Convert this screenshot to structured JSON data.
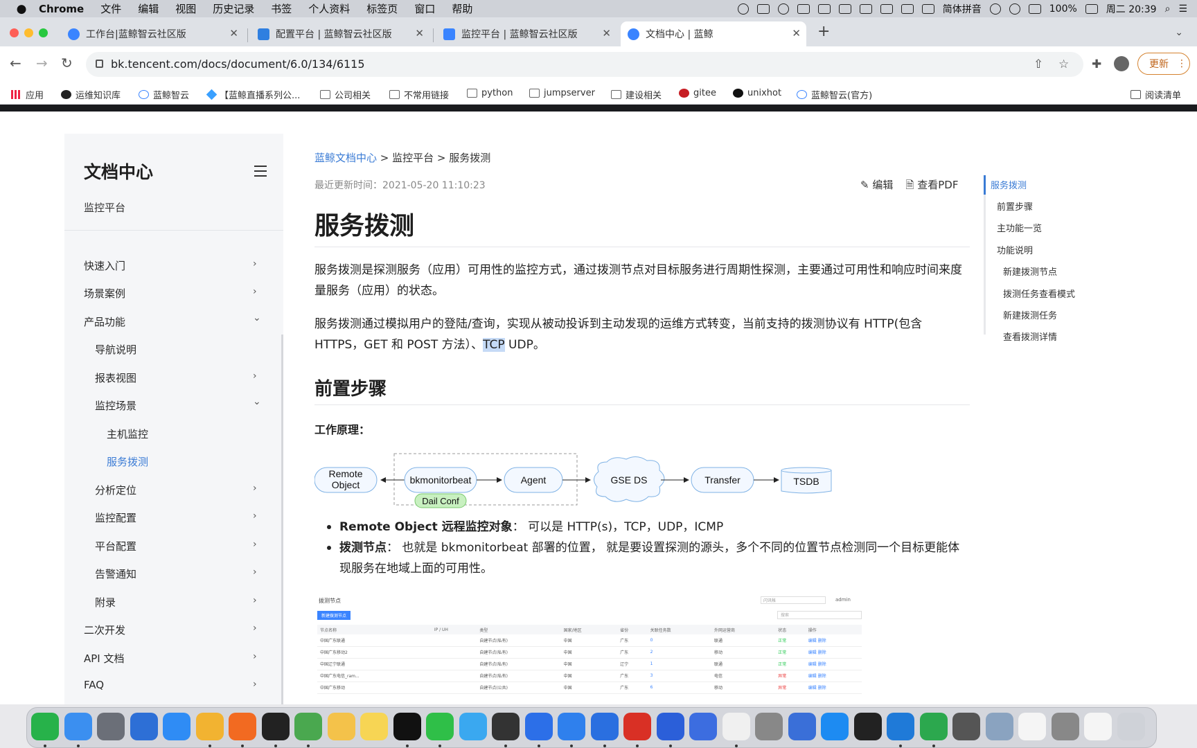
{
  "menubar": {
    "items": [
      "Chrome",
      "文件",
      "编辑",
      "视图",
      "历史记录",
      "书签",
      "个人资料",
      "标签页",
      "窗口",
      "帮助"
    ],
    "battery": "100%",
    "input_method": "简体拼音",
    "datetime": "周二 20:39"
  },
  "tabs": [
    {
      "title": "工作台|蓝鲸智云社区版",
      "active": false
    },
    {
      "title": "配置平台 | 蓝鲸智云社区版",
      "active": false
    },
    {
      "title": "监控平台 | 蓝鲸智云社区版",
      "active": false
    },
    {
      "title": "文档中心 | 蓝鲸",
      "active": true
    }
  ],
  "address": {
    "url": "bk.tencent.com/docs/document/6.0/134/6115",
    "update_label": "更新"
  },
  "bookmarks": {
    "items": [
      "应用",
      "运维知识库",
      "蓝鲸智云",
      "【蓝鲸直播系列公...",
      "公司相关",
      "不常用链接",
      "python",
      "jumpserver",
      "建设相关",
      "gitee",
      "unixhot",
      "蓝鲸智云(官方)"
    ],
    "reading_list": "阅读清单"
  },
  "sidebar": {
    "title": "文档中心",
    "subtitle": "监控平台",
    "items": [
      {
        "label": "快速入门",
        "arrow": "›"
      },
      {
        "label": "场景案例",
        "arrow": "›"
      },
      {
        "label": "产品功能",
        "arrow": "⌄"
      },
      {
        "label": "导航说明",
        "arrow": ""
      },
      {
        "label": "报表视图",
        "arrow": "›"
      },
      {
        "label": "监控场景",
        "arrow": "⌄"
      },
      {
        "label": "主机监控",
        "arrow": ""
      },
      {
        "label": "服务拨测",
        "arrow": ""
      },
      {
        "label": "分析定位",
        "arrow": "›"
      },
      {
        "label": "监控配置",
        "arrow": "›"
      },
      {
        "label": "平台配置",
        "arrow": "›"
      },
      {
        "label": "告警通知",
        "arrow": "›"
      },
      {
        "label": "附录",
        "arrow": "›"
      },
      {
        "label": "二次开发",
        "arrow": "›"
      },
      {
        "label": "API 文档",
        "arrow": "›"
      },
      {
        "label": "FAQ",
        "arrow": "›"
      }
    ]
  },
  "content": {
    "breadcrumb": {
      "root": "蓝鲸文档中心",
      "sep1": " > ",
      "mid": "监控平台",
      "sep2": " > ",
      "current": "服务拨测"
    },
    "updated": "最近更新时间：2021-05-20 11:10:23",
    "edit_label": "编辑",
    "pdf_label": "查看PDF",
    "title": "服务拨测",
    "intro": "服务拨测是探测服务（应用）可用性的监控方式，通过拨测节点对目标服务进行周期性探测，主要通过可用性和响应时间来度量服务（应用）的状态。",
    "protocols_before": "服务拨测通过模拟用户的登陆/查询，实现从被动投诉到主动发现的运维方式转变，当前支持的拨测协议有 HTTP(包含 HTTPS，GET 和 POST 方法）、",
    "protocols_highlight": "TCP",
    "protocols_after": " UDP。",
    "section_title": "前置步骤",
    "principle_label": "工作原理：",
    "diagram": {
      "remote_line1": "Remote",
      "remote_line2": "Object",
      "bkmonitorbeat": "bkmonitorbeat",
      "agent": "Agent",
      "dail_conf": "Dail Conf",
      "gse": "GSE DS",
      "transfer": "Transfer",
      "tsdb": "TSDB"
    },
    "bullets": [
      {
        "bold": "Remote Object 远程监控对象",
        "text": "：  可以是 HTTP(s)，TCP，UDP，ICMP"
      },
      {
        "bold": "拨测节点",
        "text": "：  也就是 bkmonitorbeat 部署的位置， 就是要设置探测的源头，多个不同的位置节点检测同一个目标更能体现服务在地域上面的可用性。"
      }
    ],
    "screenshot": {
      "title": "拨测节点",
      "select": "闪讯帐",
      "admin": "admin",
      "new_button": "新建拨测节点",
      "search": "搜索",
      "columns": [
        "节点名称",
        "IP / UH",
        "类型",
        "国家/地区",
        "省份",
        "关联任务数",
        "外网运营商",
        "状态",
        "操作"
      ],
      "rows": [
        [
          "中国广东联通",
          "",
          "自建节点(私有)",
          "中国",
          "广东",
          "0",
          "联通",
          "正常",
          "编辑 删除"
        ],
        [
          "中国广东移动2",
          "",
          "自建节点(私有)",
          "中国",
          "广东",
          "2",
          "移动",
          "正常",
          "编辑 删除"
        ],
        [
          "中国辽宁联通",
          "",
          "自建节点(私有)",
          "中国",
          "辽宁",
          "1",
          "联通",
          "正常",
          "编辑 删除"
        ],
        [
          "中国广东电信_ram...",
          "",
          "自建节点(私有)",
          "中国",
          "广东",
          "3",
          "电信",
          "异常",
          "编辑 删除"
        ],
        [
          "中国广东移动",
          "",
          "自建节点(公共)",
          "中国",
          "广东",
          "6",
          "移动",
          "异常",
          "编辑 删除"
        ]
      ]
    }
  },
  "toc": {
    "items": [
      "服务拨测",
      "前置步骤",
      "主功能一览",
      "功能说明",
      "新建拨测节点",
      "拨测任务查看模式",
      "新建拨测任务",
      "查看拨测详情"
    ]
  },
  "dock": {
    "apps": [
      "iqiyi",
      "finder",
      "launchpad",
      "thunderbird",
      "safari",
      "chrome",
      "firefox",
      "typora",
      "evernote",
      "photos",
      "notes",
      "qq",
      "wechat",
      "qq-music",
      "terminal-app",
      "lark",
      "vpn",
      "feishu",
      "wps",
      "word",
      "kuai",
      "keynote",
      "proxyman",
      "xmind",
      "infuse",
      "terminal",
      "vscode",
      "pycharm",
      "screenflow",
      "preview",
      "textedit",
      "settings",
      "notes2",
      "trash"
    ]
  }
}
